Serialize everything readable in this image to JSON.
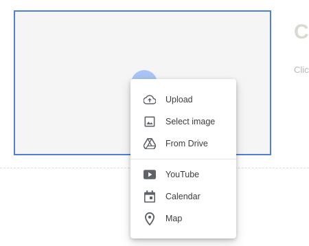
{
  "page": {
    "heading": "Cl",
    "subtext": "Clicl"
  },
  "insert_menu": {
    "items": [
      {
        "label": "Upload",
        "icon": "cloud-upload-icon"
      },
      {
        "label": "Select image",
        "icon": "image-icon"
      },
      {
        "label": "From Drive",
        "icon": "drive-icon"
      }
    ],
    "embed_items": [
      {
        "label": "YouTube",
        "icon": "youtube-icon"
      },
      {
        "label": "Calendar",
        "icon": "calendar-icon"
      },
      {
        "label": "Map",
        "icon": "map-pin-icon"
      }
    ]
  },
  "colors": {
    "selection_border": "#4f7fd9",
    "fab": "#a9c4f5",
    "icon": "#5f6368"
  }
}
